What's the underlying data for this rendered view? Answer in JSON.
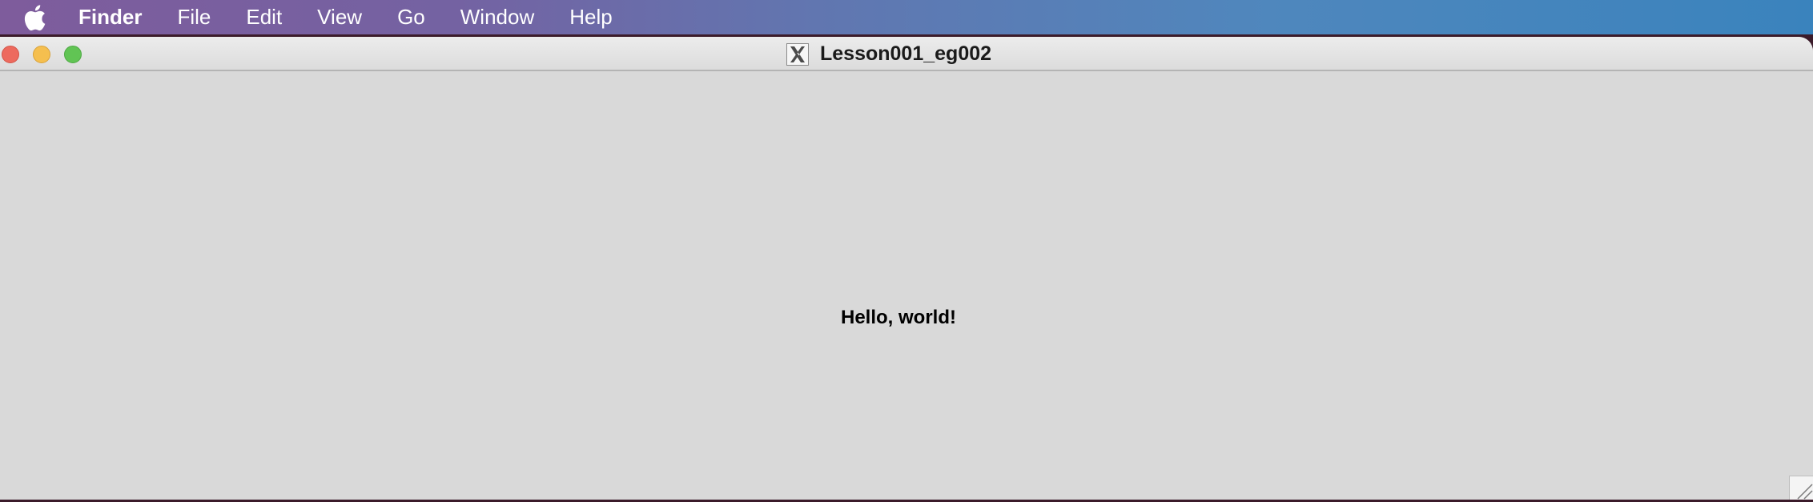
{
  "menubar": {
    "app_name": "Finder",
    "items": [
      "File",
      "Edit",
      "View",
      "Go",
      "Window",
      "Help"
    ]
  },
  "window": {
    "title": "Lesson001_eg002",
    "content_text": "Hello, world!"
  },
  "icons": {
    "apple": "apple-logo-icon",
    "window_app": "x11-icon",
    "resize": "resize-grip-icon"
  },
  "colors": {
    "close": "#ed6a5e",
    "minimize": "#f5bf4f",
    "maximize": "#61c454",
    "window_background": "#d9d9d9"
  }
}
